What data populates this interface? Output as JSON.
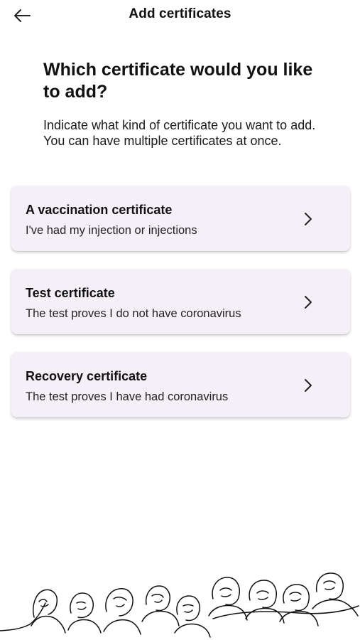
{
  "header": {
    "title": "Add certificates",
    "back_icon": "arrow-left-icon"
  },
  "main": {
    "heading": "Which certificate would you like to add?",
    "intro": "Indicate what kind of certificate you want to add. You can have multiple certificates at once."
  },
  "options": [
    {
      "title": "A vaccination certificate",
      "subtitle": "I've had my injection or injections",
      "icon": "chevron-right-icon"
    },
    {
      "title": "Test certificate",
      "subtitle": "The test proves I do not have coronavirus",
      "icon": "chevron-right-icon"
    },
    {
      "title": "Recovery certificate",
      "subtitle": "The test proves I have had coronavirus",
      "icon": "chevron-right-icon"
    }
  ],
  "footer_illustration": "people-crowd-line-illustration",
  "colors": {
    "card_background": "#f5f0f7",
    "text": "#111111",
    "background": "#ffffff"
  }
}
